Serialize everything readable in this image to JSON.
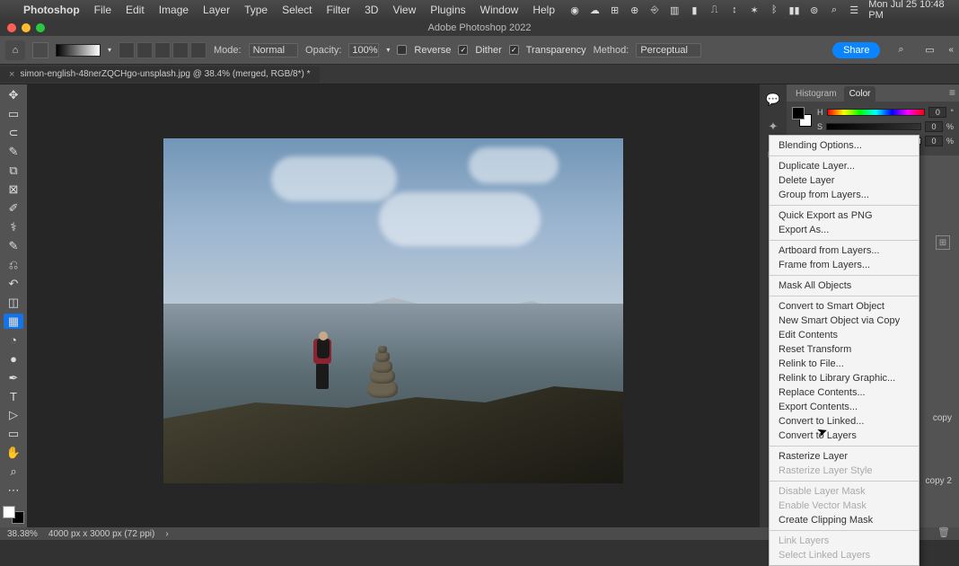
{
  "menubar": {
    "items": [
      "Photoshop",
      "File",
      "Edit",
      "Image",
      "Layer",
      "Type",
      "Select",
      "Filter",
      "3D",
      "View",
      "Plugins",
      "Window",
      "Help"
    ],
    "datetime": "Mon Jul 25  10:48 PM"
  },
  "titlebar": {
    "title": "Adobe Photoshop 2022"
  },
  "options": {
    "mode_label": "Mode:",
    "mode_value": "Normal",
    "opacity_label": "Opacity:",
    "opacity_value": "100%",
    "reverse": "Reverse",
    "dither": "Dither",
    "transparency": "Transparency",
    "method_label": "Method:",
    "method_value": "Perceptual",
    "share": "Share"
  },
  "tab": {
    "title": "simon-english-48nerZQCHgo-unsplash.jpg @ 38.4% (merged, RGB/8*) *",
    "close": "×"
  },
  "panel_tabs": {
    "histogram": "Histogram",
    "color": "Color"
  },
  "hsb": {
    "h": "0",
    "s": "0",
    "b": "0",
    "pct": "%"
  },
  "context_menu": {
    "items": [
      {
        "label": "Blending Options...",
        "sep": true
      },
      {
        "label": "Duplicate Layer..."
      },
      {
        "label": "Delete Layer"
      },
      {
        "label": "Group from Layers...",
        "sep": true
      },
      {
        "label": "Quick Export as PNG"
      },
      {
        "label": "Export As...",
        "sep": true
      },
      {
        "label": "Artboard from Layers..."
      },
      {
        "label": "Frame from Layers...",
        "sep": true
      },
      {
        "label": "Mask All Objects",
        "sep": true
      },
      {
        "label": "Convert to Smart Object"
      },
      {
        "label": "New Smart Object via Copy"
      },
      {
        "label": "Edit Contents"
      },
      {
        "label": "Reset Transform"
      },
      {
        "label": "Relink to File..."
      },
      {
        "label": "Relink to Library Graphic..."
      },
      {
        "label": "Replace Contents..."
      },
      {
        "label": "Export Contents..."
      },
      {
        "label": "Convert to Linked..."
      },
      {
        "label": "Convert to Layers",
        "sep": true
      },
      {
        "label": "Rasterize Layer"
      },
      {
        "label": "Rasterize Layer Style",
        "disabled": true,
        "sep": true
      },
      {
        "label": "Disable Layer Mask",
        "disabled": true
      },
      {
        "label": "Enable Vector Mask",
        "disabled": true
      },
      {
        "label": "Create Clipping Mask",
        "sep": true
      },
      {
        "label": "Link Layers",
        "disabled": true
      },
      {
        "label": "Select Linked Layers",
        "disabled": true
      }
    ]
  },
  "layers_visible": {
    "copy": "copy",
    "copy2": "copy 2"
  },
  "status": {
    "zoom": "38.38%",
    "docinfo": "4000 px x 3000 px (72 ppi)",
    "arrow": "›"
  }
}
